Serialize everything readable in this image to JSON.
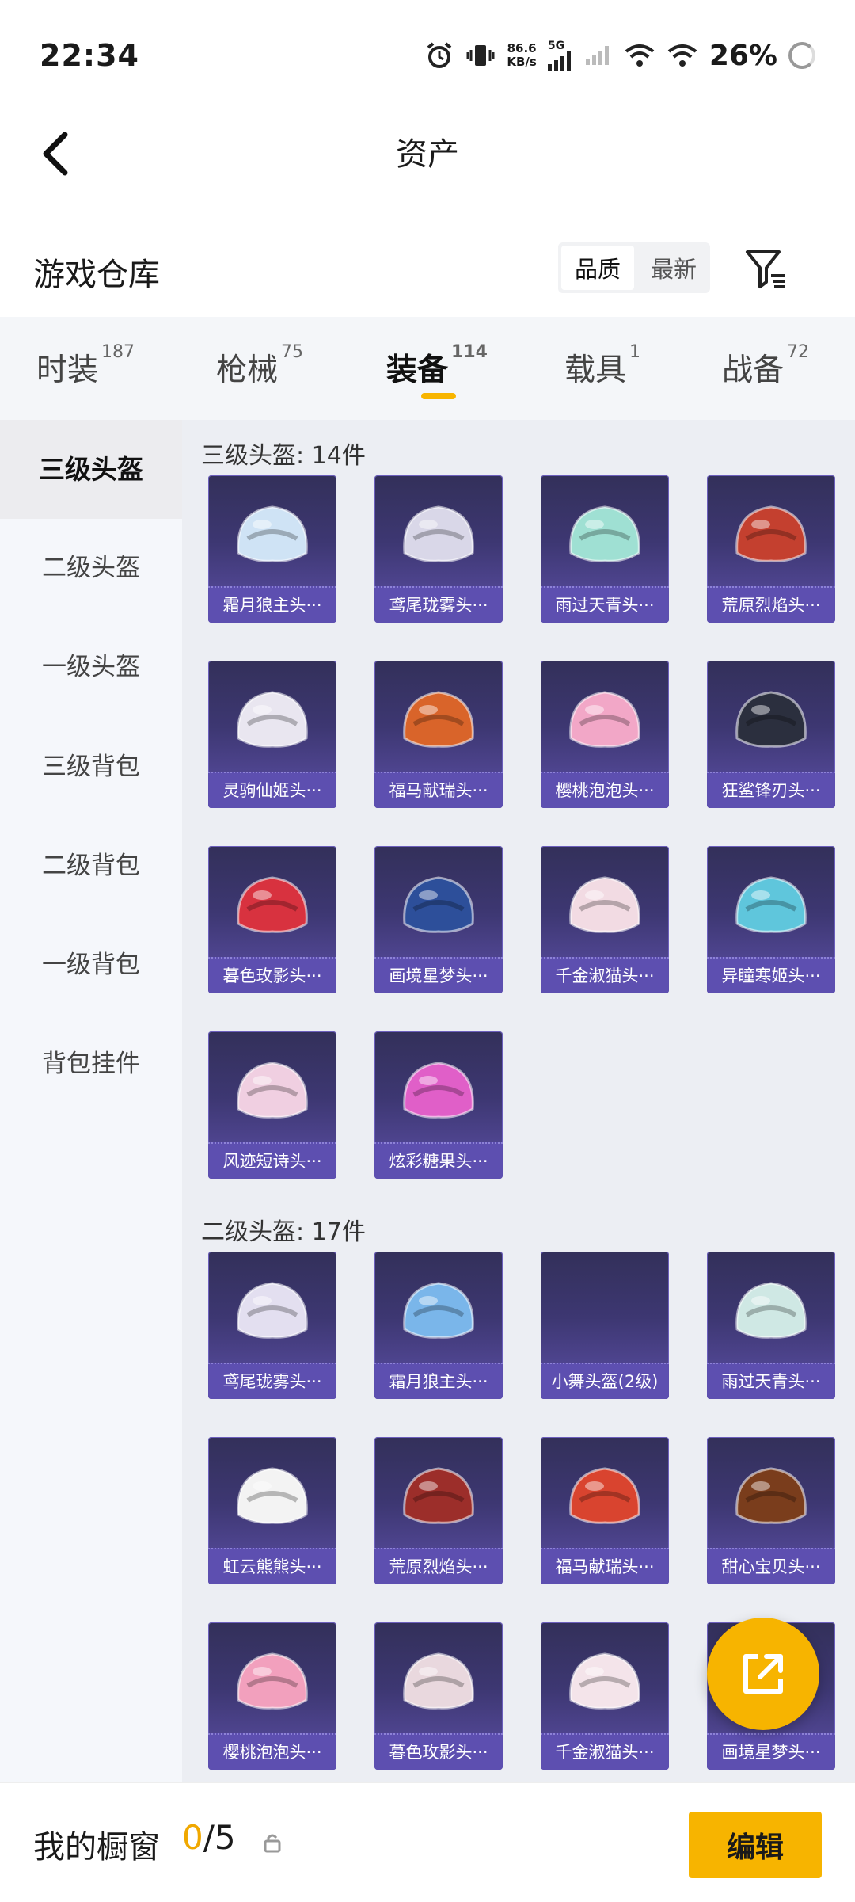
{
  "status": {
    "time": "22:34",
    "net_speed_value": "86.6",
    "net_speed_unit": "KB/s",
    "network": "5G",
    "battery": "26%"
  },
  "header": {
    "title": "资产"
  },
  "warehouse": {
    "title": "游戏仓库",
    "sort_options": [
      "品质",
      "最新"
    ],
    "active_sort": "品质"
  },
  "tabs": [
    {
      "label": "时装",
      "count": "187"
    },
    {
      "label": "枪械",
      "count": "75"
    },
    {
      "label": "装备",
      "count": "114"
    },
    {
      "label": "载具",
      "count": "1"
    },
    {
      "label": "战备",
      "count": "72"
    }
  ],
  "active_tab": "装备",
  "sidebar": {
    "items": [
      "三级头盔",
      "二级头盔",
      "一级头盔",
      "三级背包",
      "二级背包",
      "一级背包",
      "背包挂件"
    ],
    "active": "三级头盔"
  },
  "sections": [
    {
      "title": "三级头盔: 14件",
      "items": [
        {
          "name": "霜月狼主头···",
          "color": "#cfe3f5"
        },
        {
          "name": "鸢尾珑雾头···",
          "color": "#d9d7e8"
        },
        {
          "name": "雨过天青头···",
          "color": "#9fe0d3"
        },
        {
          "name": "荒原烈焰头···",
          "color": "#c4402f"
        },
        {
          "name": "灵驹仙姬头···",
          "color": "#e9e6f0"
        },
        {
          "name": "福马献瑞头···",
          "color": "#d9642a"
        },
        {
          "name": "樱桃泡泡头···",
          "color": "#f2a7c7"
        },
        {
          "name": "狂鲨锋刃头···",
          "color": "#2b2f3e"
        },
        {
          "name": "暮色玫影头···",
          "color": "#d8323f"
        },
        {
          "name": "画境星梦头···",
          "color": "#2d4f9a"
        },
        {
          "name": "千金淑猫头···",
          "color": "#f2dbe3"
        },
        {
          "name": "异瞳寒姬头···",
          "color": "#5fc6dc"
        },
        {
          "name": "风迹短诗头···",
          "color": "#f0cfe1"
        },
        {
          "name": "炫彩糖果头···",
          "color": "#e05fc8"
        }
      ]
    },
    {
      "title": "二级头盔: 17件",
      "items": [
        {
          "name": "鸢尾珑雾头···",
          "color": "#e3dff0"
        },
        {
          "name": "霜月狼主头···",
          "color": "#7ab6ea"
        },
        {
          "name": "小舞头盔(2级)",
          "color": ""
        },
        {
          "name": "雨过天青头···",
          "color": "#cfe8e4"
        },
        {
          "name": "虹云熊熊头···",
          "color": "#f3f3f3"
        },
        {
          "name": "荒原烈焰头···",
          "color": "#9c2e2a"
        },
        {
          "name": "福马献瑞头···",
          "color": "#d9442f"
        },
        {
          "name": "甜心宝贝头···",
          "color": "#7a3d1c"
        },
        {
          "name": "樱桃泡泡头···",
          "color": "#f2a0bd"
        },
        {
          "name": "暮色玫影头···",
          "color": "#e9d8de"
        },
        {
          "name": "千金淑猫头···",
          "color": "#f4e4ea"
        },
        {
          "name": "画境星梦头···",
          "color": "#3a3f6a"
        }
      ]
    }
  ],
  "showcase": {
    "label": "我的橱窗",
    "current": "0",
    "sep_total": "/5"
  },
  "edit_label": "编辑"
}
